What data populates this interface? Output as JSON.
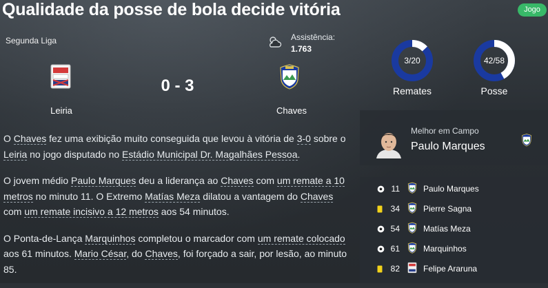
{
  "headline": "Qualidade da posse de bola decide vitória",
  "badge": "Jogo",
  "league": "Segunda Liga",
  "attendance": {
    "label": "Assistência:",
    "value": "1.763"
  },
  "weather_icon": "partly-cloudy-icon",
  "score": "0 - 3",
  "home_team": "Leiria",
  "away_team": "Chaves",
  "stats": [
    {
      "value": "3/20",
      "label": "Remates",
      "home": 3,
      "away": 20
    },
    {
      "value": "42/58",
      "label": "Posse",
      "home": 42,
      "away": 58
    }
  ],
  "colors": {
    "accent": "#38b868",
    "home": "#ffffff",
    "away": "#1a3aa0",
    "yellow_card": "#f2d21b"
  },
  "report": {
    "p1": {
      "t1": "O ",
      "a": "Chaves",
      "t2": " fez uma exibição muito conseguida que levou à vitória de ",
      "b": "3-0",
      "t3": " sobre o ",
      "c": "Leiria",
      "t4": " no jogo disputado no ",
      "d": "Estádio Municipal Dr. Magalhães Pessoa",
      "t5": "."
    },
    "p2": {
      "t1": "O jovem médio ",
      "a": "Paulo Marques",
      "t2": " deu a liderança ao ",
      "b": "Chaves",
      "t3": " com ",
      "c": "um remate a 10 metros",
      "t4": " no minuto 11. O Extremo ",
      "d": "Matías Meza",
      "t5": " dilatou a vantagem do ",
      "e": "Chaves",
      "t6": " com ",
      "f": "um remate incisivo a 12 metros",
      "t7": " aos 54 minutos."
    },
    "p3": {
      "t1": "O Ponta-de-Lança ",
      "a": "Marquinhos",
      "t2": " completou o marcador com ",
      "b": "um remate colocado",
      "t3": " aos 61 minutos. ",
      "c": "Mario César",
      "t4": ", do ",
      "d": "Chaves",
      "t5": ", foi forçado a sair, por lesão, ao minuto 85."
    }
  },
  "potm": {
    "label": "Melhor em Campo",
    "name": "Paulo Marques"
  },
  "events": [
    {
      "type": "goal",
      "icon": "ball-icon",
      "minute": "11",
      "team": "Chaves",
      "player": "Paulo Marques"
    },
    {
      "type": "yellow",
      "icon": "yellow-card-icon",
      "minute": "34",
      "team": "Chaves",
      "player": "Pierre Sagna"
    },
    {
      "type": "goal",
      "icon": "ball-icon",
      "minute": "54",
      "team": "Chaves",
      "player": "Matías Meza"
    },
    {
      "type": "goal",
      "icon": "ball-icon",
      "minute": "61",
      "team": "Chaves",
      "player": "Marquinhos"
    },
    {
      "type": "yellow",
      "icon": "yellow-card-icon",
      "minute": "82",
      "team": "Leiria",
      "player": "Felipe Araruna"
    }
  ]
}
